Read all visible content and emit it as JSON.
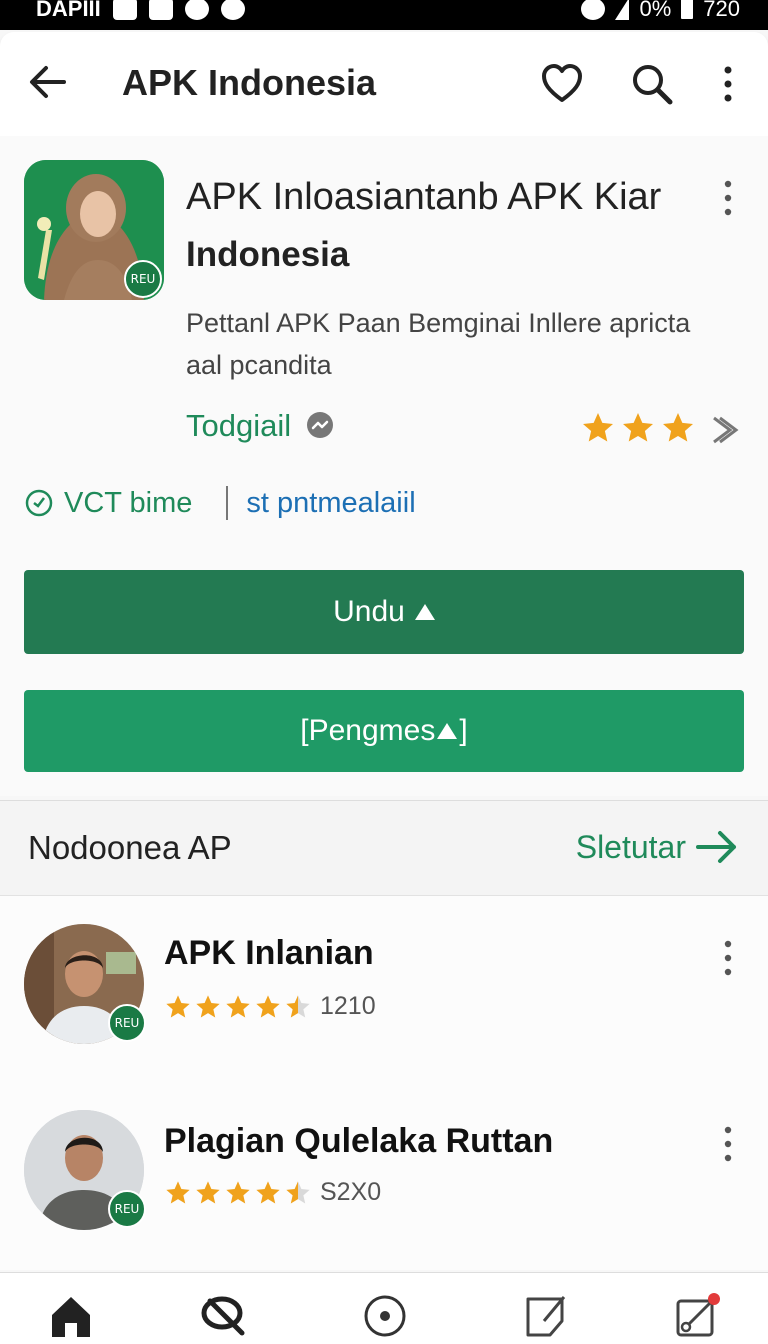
{
  "status_bar": {
    "carrier": "DAPIII",
    "battery": "0%",
    "time": "720"
  },
  "app_bar": {
    "title": "APK Indonesia"
  },
  "app": {
    "name_line1": "APK Inloasiantanb APK Kiar",
    "name_line2": "Indonesia",
    "icon_badge": "REU",
    "description": "Pettanl APK Paan Bemginai Inllere apricta aal pcandita",
    "developer": "Todgiail",
    "rating_stars": 3,
    "meta_left": "VCT bime",
    "meta_right": "st pntmealaiil",
    "primary_button": "Undu",
    "secondary_button_prefix": "[Pengmes",
    "secondary_button_suffix": "]"
  },
  "section": {
    "title": "Nodoonea AP",
    "more_label": "Sletutar"
  },
  "list": [
    {
      "name": "APK Inlanian",
      "badge": "REU",
      "rating_stars": 4.5,
      "count": "1210"
    },
    {
      "name": "Plagian Qulelaka Ruttan",
      "badge": "REU",
      "rating_stars": 4.5,
      "count": "S2X0"
    }
  ],
  "colors": {
    "primary": "#237a52",
    "secondary": "#1f9a66",
    "accent_green": "#1f8a5a",
    "link_blue": "#1c6fb4",
    "star": "#f0a21c"
  },
  "icons": [
    "arrow-left-icon",
    "heart-icon",
    "search-icon",
    "more-vert-icon",
    "chat-icon",
    "star-icon",
    "chevron-right-icon",
    "clock-icon",
    "arrow-right-icon",
    "home-icon",
    "discover-icon",
    "record-icon",
    "note-icon",
    "edit-icon"
  ]
}
